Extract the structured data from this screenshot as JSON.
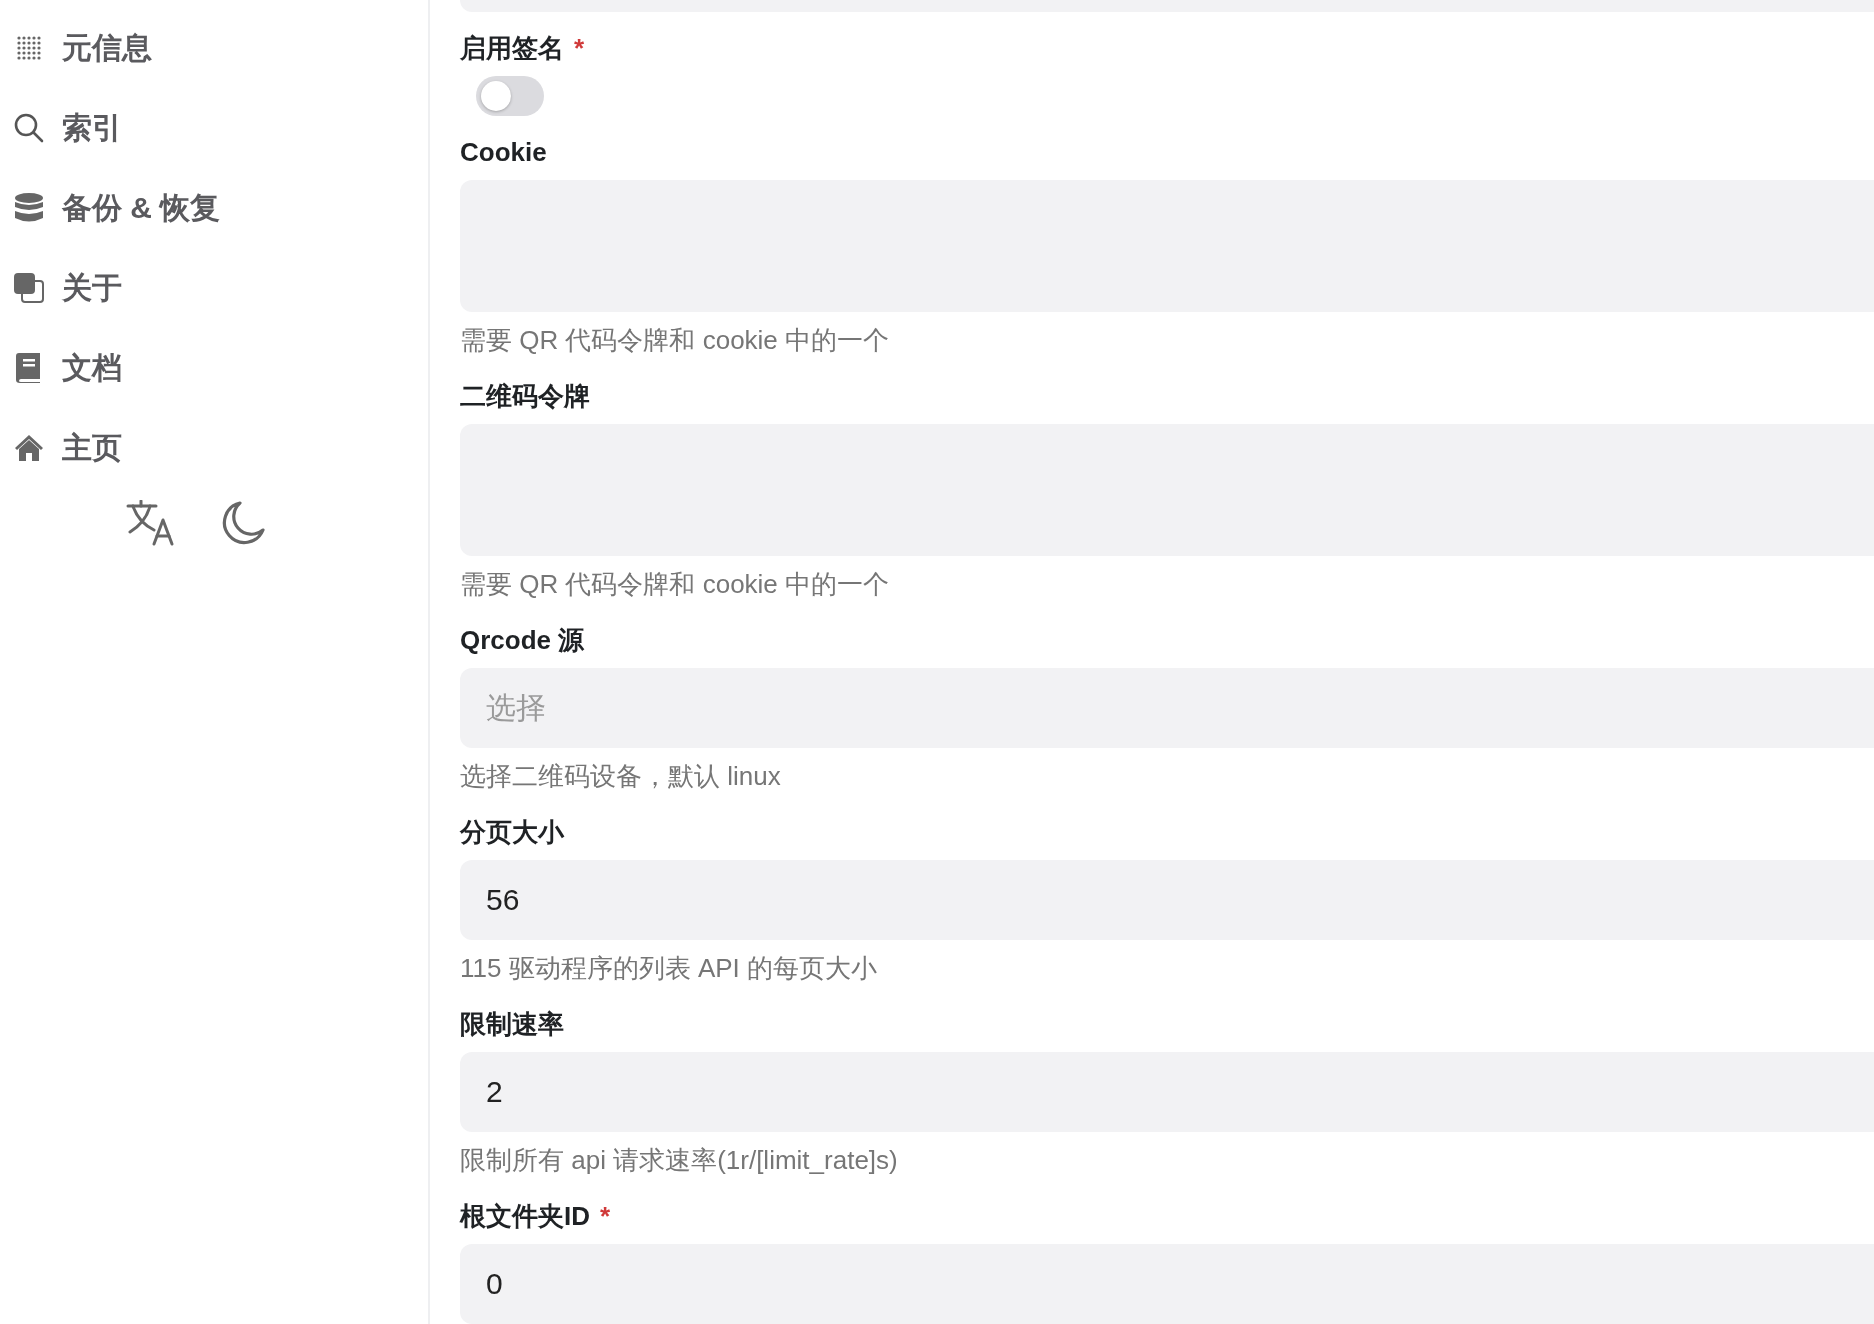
{
  "sidebar": {
    "items": [
      {
        "label": "元信息",
        "selected": false
      },
      {
        "label": "索引",
        "selected": false
      },
      {
        "label": "备份 & 恢复",
        "selected": false
      },
      {
        "label": "关于",
        "selected": false
      },
      {
        "label": "文档",
        "selected": false
      },
      {
        "label": "主页",
        "selected": false
      }
    ]
  },
  "form": {
    "fields": [
      {
        "kind": "cut"
      },
      {
        "kind": "switch",
        "label": "启用签名",
        "required_mark": "*",
        "on": false
      },
      {
        "kind": "textarea",
        "label": "Cookie",
        "hint": "需要 QR 代码令牌和 cookie 中的一个"
      },
      {
        "kind": "textarea",
        "label": "二维码令牌",
        "hint": "需要 QR 代码令牌和 cookie 中的一个"
      },
      {
        "kind": "select",
        "label": "Qrcode 源",
        "placeholder": "选择",
        "hint": "选择二维码设备，默认 linux"
      },
      {
        "kind": "input",
        "label": "分页大小",
        "value": "56",
        "hint": "115 驱动程序的列表 API 的每页大小"
      },
      {
        "kind": "input",
        "label": "限制速率",
        "value": "2",
        "hint": "限制所有 api 请求速率(1r/[limit_rate]s)"
      },
      {
        "kind": "input",
        "label": "根文件夹ID",
        "required_mark": "*",
        "value": "0"
      }
    ]
  }
}
